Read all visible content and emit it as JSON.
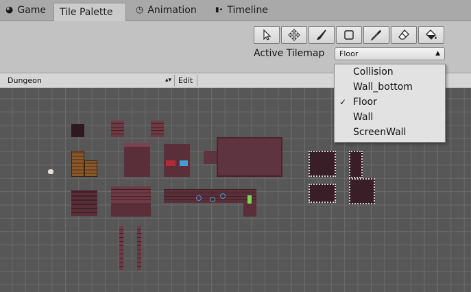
{
  "tabs": [
    {
      "label": "Game",
      "icon": "game-icon"
    },
    {
      "label": "Tile Palette",
      "icon": "",
      "active": true
    },
    {
      "label": "Animation",
      "icon": "clock-icon"
    },
    {
      "label": "Timeline",
      "icon": "timeline-icon"
    }
  ],
  "toolbar": {
    "tools": [
      "select-tool-icon",
      "move-tool-icon",
      "paint-brush-icon",
      "box-fill-icon",
      "picker-icon",
      "eraser-icon",
      "flood-fill-icon"
    ]
  },
  "active_tilemap": {
    "label": "Active Tilemap",
    "value": "Floor"
  },
  "palette_bar": {
    "palette_value": "Dungeon",
    "edit_label": "Edit"
  },
  "dropdown": {
    "options": [
      "Collision",
      "Wall_bottom",
      "Floor",
      "Wall",
      "ScreenWall"
    ],
    "selected": "Floor"
  },
  "colors": {
    "grid_bg": "#575757",
    "tile_dark": "#5a2f3a",
    "tile_brick": "#6e3a46",
    "crate": "#8a5a2b"
  }
}
